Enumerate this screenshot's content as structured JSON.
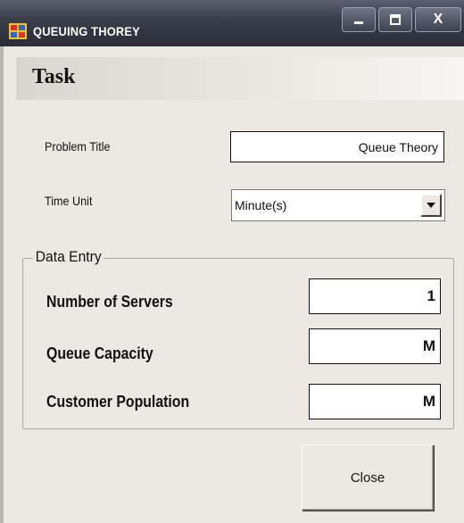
{
  "window": {
    "title": "QUEUING THOREY",
    "close_glyph": "X",
    "icons": [
      "app-icon",
      "minimize-icon",
      "maximize-icon",
      "close-icon"
    ]
  },
  "task": {
    "title": "Task"
  },
  "problem_title": {
    "label": "Problem Title",
    "value": "Queue Theory"
  },
  "time_unit": {
    "label": "Time Unit",
    "selected": "Minute(s)"
  },
  "data_entry": {
    "legend": "Data Entry",
    "servers": {
      "label": "Number of Servers",
      "value": "1"
    },
    "capacity": {
      "label": "Queue Capacity",
      "value": "M"
    },
    "population": {
      "label": "Customer Population",
      "value": "M"
    }
  },
  "buttons": {
    "close": "Close"
  },
  "colors": {
    "titlebar": "#3b3f4c",
    "client": "#ece9e4",
    "field": "#ffffff"
  }
}
